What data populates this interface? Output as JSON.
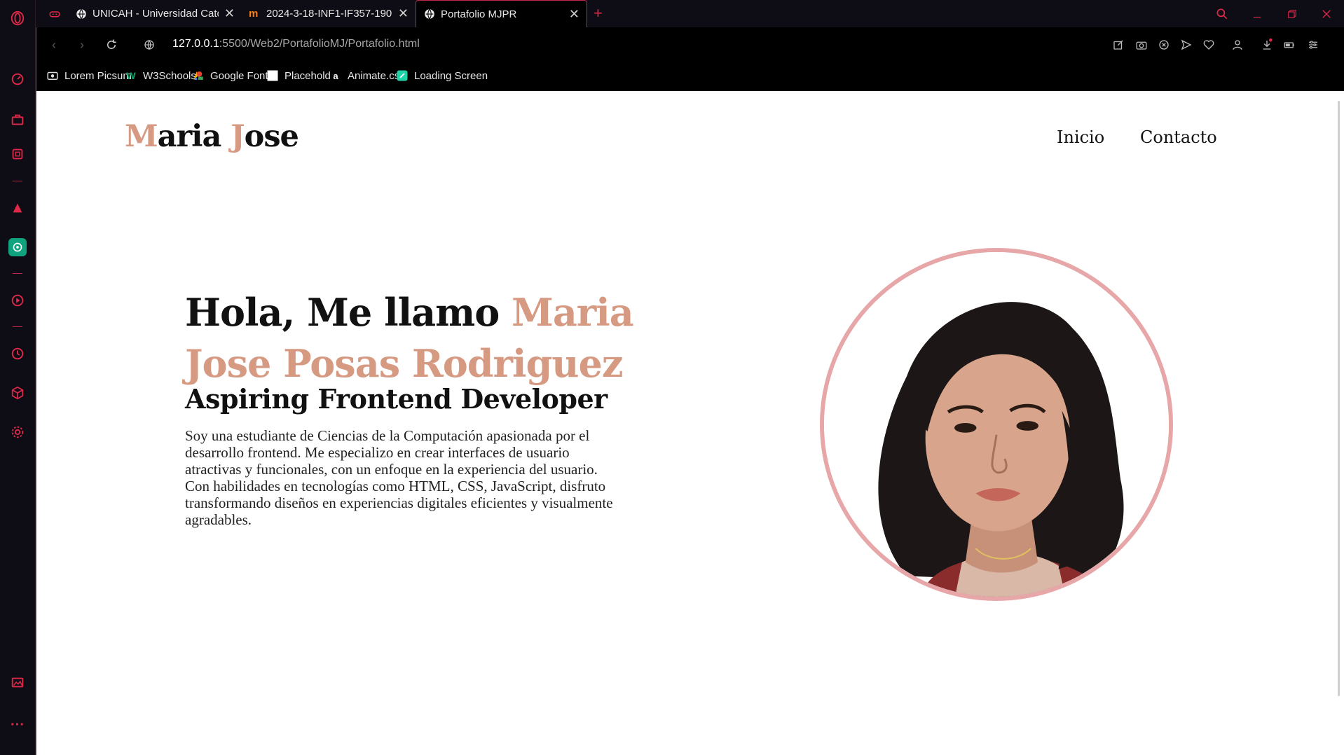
{
  "browser": {
    "tabs": [
      {
        "title": "UNICAH - Universidad Cató",
        "favicon": "globe-icon",
        "active": false
      },
      {
        "title": "2024-3-18-INF1-IF357-190",
        "favicon": "moodle-icon",
        "active": false
      },
      {
        "title": "Portafolio MJPR",
        "favicon": "globe-icon",
        "active": true
      }
    ],
    "address": {
      "host": "127.0.0.1",
      "path": ":5500/Web2/PortafolioMJ/Portafolio.html"
    },
    "bookmarks": [
      {
        "label": "Lorem Picsum",
        "icon": "image-icon"
      },
      {
        "label": "W3Schools",
        "icon": "w3schools-icon"
      },
      {
        "label": "Google Fonts",
        "icon": "google-fonts-icon"
      },
      {
        "label": "Placehold",
        "icon": "placehold-icon"
      },
      {
        "label": "Animate.css",
        "icon": "animate-icon"
      },
      {
        "label": "Loading Screen",
        "icon": "loading-icon"
      }
    ],
    "accent_color": "#e0284a"
  },
  "site": {
    "logo": {
      "first_initial": "M",
      "first_rest": "aria ",
      "second_initial": "J",
      "second_rest": "ose"
    },
    "nav": {
      "home": "Inicio",
      "contact": "Contacto"
    },
    "hero": {
      "greeting": "Hola, Me llamo ",
      "name": "Maria Jose Posas Rodriguez",
      "subtitle": "Aspiring Frontend Developer",
      "description": "Soy una estudiante de Ciencias de la Computación apasionada por el desarrollo frontend. Me especializo en crear interfaces de usuario atractivas y funcionales, con un enfoque en la experiencia del usuario. Con habilidades en tecnologías como HTML, CSS, JavaScript, disfruto transformando diseños en experiencias digitales eficientes y visualmente agradables."
    },
    "colors": {
      "accent": "#d69a82",
      "ring": "#e7a7a8",
      "text": "#111111"
    }
  }
}
